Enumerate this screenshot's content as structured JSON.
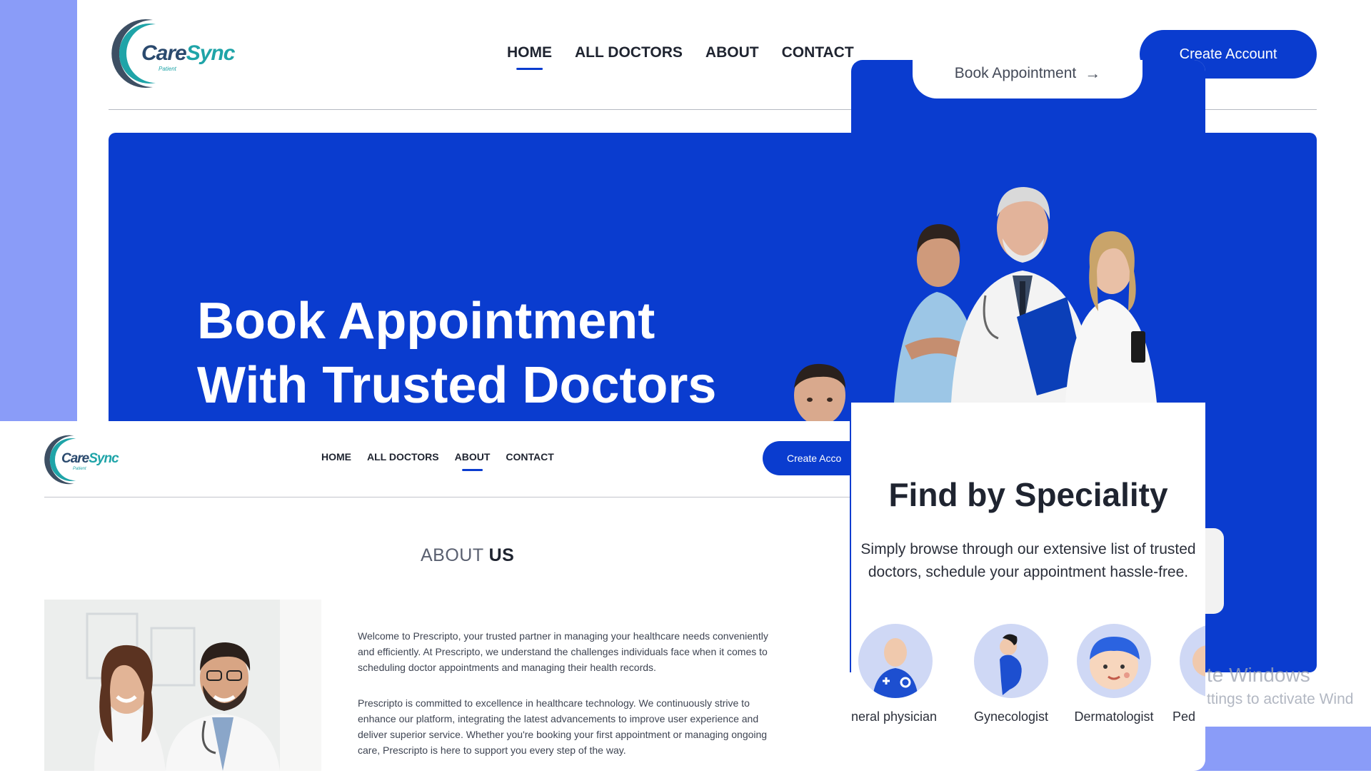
{
  "main": {
    "logo": {
      "name_a": "Care",
      "name_b": "Sync",
      "tagline": "Patient"
    },
    "nav": [
      {
        "label": "HOME",
        "active": true
      },
      {
        "label": "ALL DOCTORS",
        "active": false
      },
      {
        "label": "ABOUT",
        "active": false
      },
      {
        "label": "CONTACT",
        "active": false
      }
    ],
    "create_account": "Create Account",
    "hero": {
      "line1": "Book Appointment",
      "line2": "With Trusted Doctors"
    }
  },
  "about": {
    "logo": {
      "name_a": "Care",
      "name_b": "Sync",
      "tagline": "Patient"
    },
    "nav": [
      {
        "label": "HOME",
        "active": false
      },
      {
        "label": "ALL DOCTORS",
        "active": false
      },
      {
        "label": "ABOUT",
        "active": true
      },
      {
        "label": "CONTACT",
        "active": false
      }
    ],
    "create_account": "Create Acco",
    "heading_light": "ABOUT",
    "heading_bold": "US",
    "paragraphs": [
      "Welcome to Prescripto, your trusted partner in managing your healthcare needs conveniently and efficiently. At Prescripto, we understand the challenges individuals face when it comes to scheduling doctor appointments and managing their health records.",
      "Prescripto is committed to excellence in healthcare technology. We continuously strive to enhance our platform, integrating the latest advancements to improve user experience and deliver superior service. Whether you're booking your first appointment or managing ongoing care, Prescripto is here to support you every step of the way."
    ]
  },
  "speciality": {
    "book_button": "Book Appointment",
    "title": "Find by Speciality",
    "description_line1": "Simply browse through our extensive list of trusted",
    "description_line2": "doctors, schedule your appointment hassle-free.",
    "items": [
      {
        "label": "neral physician",
        "icon": "general-physician-icon"
      },
      {
        "label": "Gynecologist",
        "icon": "gynecologist-icon"
      },
      {
        "label": "Dermatologist",
        "icon": "dermatologist-icon"
      },
      {
        "label": "Ped",
        "icon": "pediatrician-icon"
      }
    ]
  },
  "windows_watermark": {
    "line1": "te Windows",
    "line2": "ttings to activate Wind"
  },
  "colors": {
    "brand_blue": "#0a3ccf",
    "backdrop": "#8a9cf8",
    "teal": "#1fa4a8"
  }
}
